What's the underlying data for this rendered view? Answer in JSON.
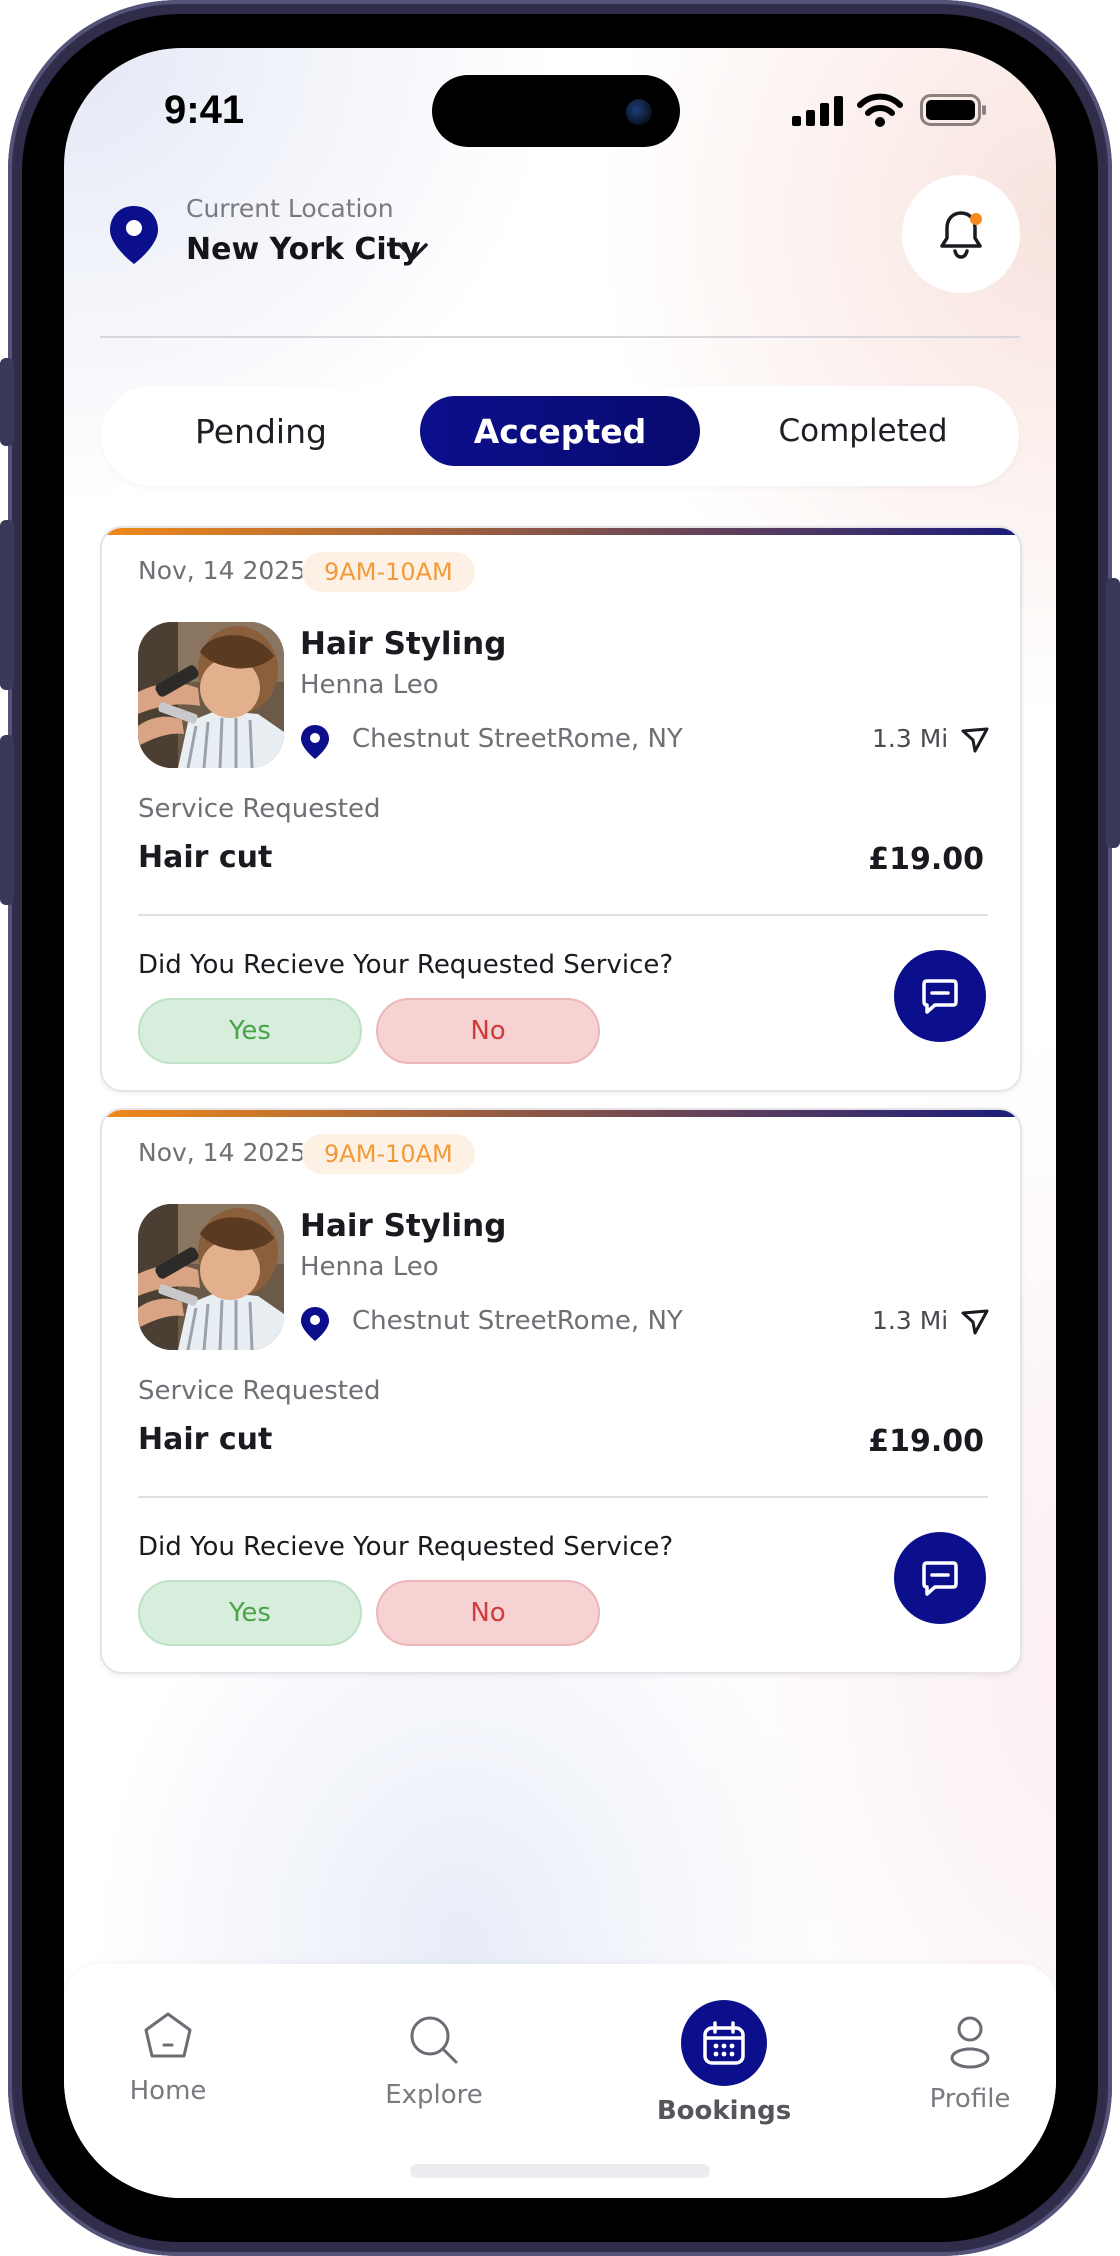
{
  "status_bar": {
    "time": "9:41"
  },
  "location": {
    "caption": "Current Location",
    "city": "New York City"
  },
  "tabs": [
    {
      "label": "Pending"
    },
    {
      "label": "Accepted"
    },
    {
      "label": "Completed"
    }
  ],
  "bookings": [
    {
      "date": "Nov, 14  2025",
      "time_slot": "9AM-10AM",
      "service_title": "Hair Styling",
      "provider": "Henna Leo",
      "address": "Chestnut StreetRome, NY",
      "distance": "1.3 Mi",
      "requested_label": "Service Requested",
      "requested_service": "Hair cut",
      "price": "£19.00",
      "question": "Did You Recieve Your Requested Service?",
      "yes_label": "Yes",
      "no_label": "No"
    },
    {
      "date": "Nov, 14  2025",
      "time_slot": "9AM-10AM",
      "service_title": "Hair Styling",
      "provider": "Henna Leo",
      "address": "Chestnut StreetRome, NY",
      "distance": "1.3 Mi",
      "requested_label": "Service Requested",
      "requested_service": "Hair cut",
      "price": "£19.00",
      "question": "Did You Recieve Your Requested Service?",
      "yes_label": "Yes",
      "no_label": "No"
    }
  ],
  "bottom_nav": [
    {
      "label": "Home",
      "icon": "home-icon"
    },
    {
      "label": "Explore",
      "icon": "search-icon"
    },
    {
      "label": "Bookings",
      "icon": "calendar-icon",
      "active": true
    },
    {
      "label": "Profile",
      "icon": "user-icon"
    }
  ],
  "colors": {
    "primary": "#0c0f8c",
    "accent_orange": "#f39a38",
    "yes_bg": "#d6eedb",
    "no_bg": "#f6d2d3"
  }
}
